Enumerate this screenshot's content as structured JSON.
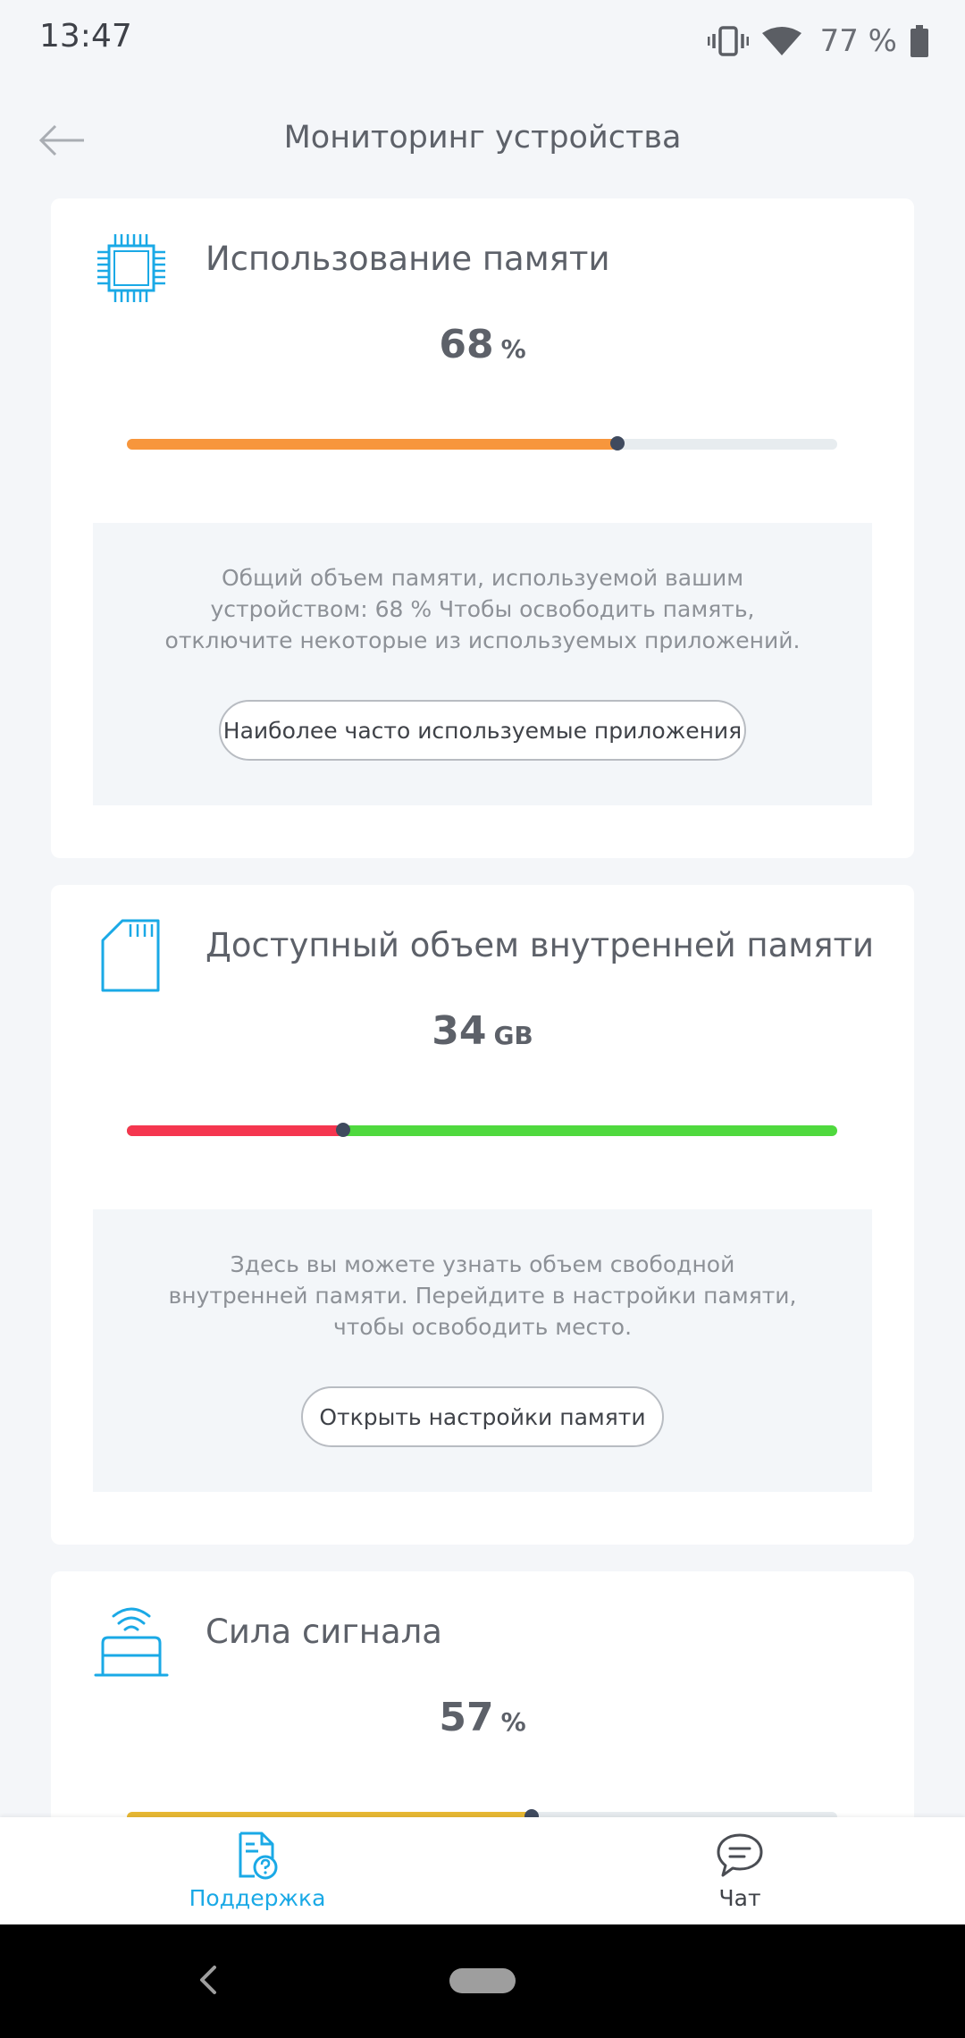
{
  "status_bar": {
    "time": "13:47",
    "battery_percent": "77 %",
    "icons": [
      "vibrate-icon",
      "wifi-icon",
      "battery-icon"
    ]
  },
  "header": {
    "title": "Мониторинг устройства",
    "back_icon": "arrow-left-icon"
  },
  "memory_card": {
    "icon": "chip-icon",
    "title": "Использование памяти",
    "value": "68",
    "unit": "%",
    "progress_fraction": 0.69,
    "bar_color": "#f7963c",
    "info_text": "Общий объем памяти, используемой вашим устройством: 68 % Чтобы освободить память, отключите некоторые из используемых приложений.",
    "button_label": "Наиболее часто используемые приложения"
  },
  "storage_card": {
    "icon": "sd-card-icon",
    "title": "Доступный объем внутренней памяти",
    "value": "34",
    "unit": "GB",
    "used_fraction": 0.305,
    "used_color": "#f5364f",
    "free_color": "#4fd93e",
    "info_text": "Здесь вы можете узнать объем свободной внутренней памяти. Перейдите в настройки памяти, чтобы освободить место.",
    "button_label": "Открыть настройки памяти"
  },
  "signal_card": {
    "icon": "router-signal-icon",
    "title": "Сила сигнала",
    "value": "57",
    "unit": "%",
    "progress_fraction": 0.57,
    "bar_color": "#e8b833"
  },
  "bottom_nav": {
    "items": [
      {
        "label": "Поддержка",
        "icon": "support-document-icon",
        "active": true
      },
      {
        "label": "Чат",
        "icon": "chat-bubble-icon",
        "active": false
      }
    ],
    "active_color": "#1aa9e6"
  },
  "system_nav": {
    "back_icon": "system-back-icon",
    "home_icon": "system-home-pill-icon"
  },
  "colors": {
    "accent": "#1aa9e6",
    "background": "#f4f6f9",
    "knob": "#3f4a5e"
  }
}
